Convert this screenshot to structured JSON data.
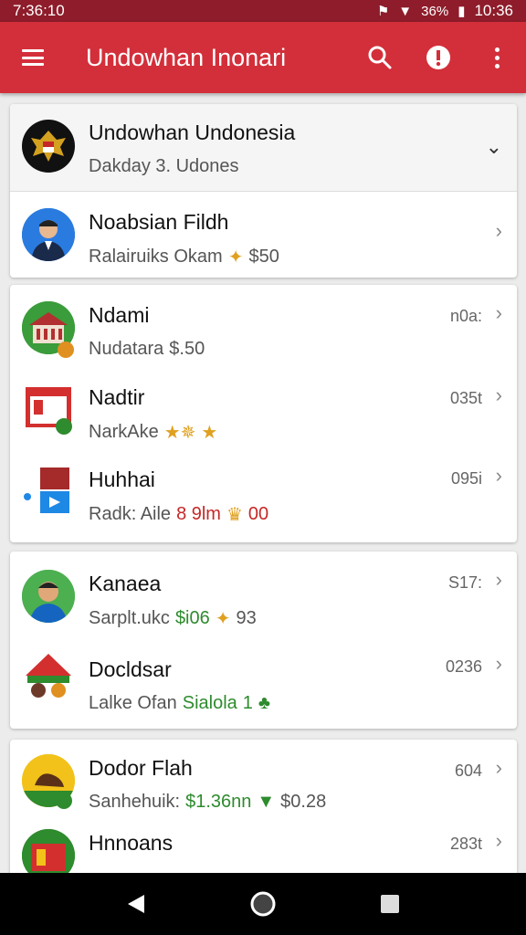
{
  "status_bar": {
    "time_left": "7:36:10",
    "time_right": "10:36",
    "battery": "36%"
  },
  "app_bar": {
    "title": "Undowhan Inonari",
    "icons": [
      "menu-icon",
      "search-icon",
      "alert-icon",
      "more-vert-icon"
    ]
  },
  "header_card": {
    "title": "Undowhan Undonesia",
    "subtitle": "Dakday 3. Udones",
    "icon": "chevron-down-icon"
  },
  "profile_row": {
    "title": "Noabsian Fildh",
    "subtitle": "Ralairuiks Okam",
    "amount": "$50"
  },
  "group1": [
    {
      "title": "Ndami",
      "subtitle": "Nudatara",
      "value": "$.50",
      "meta": "n0a:"
    },
    {
      "title": "Nadtir",
      "subtitle": "NarkAke",
      "value": "",
      "meta": "035t"
    },
    {
      "title": "Huhhai",
      "subtitle": "Radk: Aile",
      "value": "8 9lm",
      "value2": "00",
      "meta": "095i"
    }
  ],
  "group2": [
    {
      "title": "Kanaea",
      "subtitle": "Sarplt.ukc",
      "value": "$i06",
      "value2": "93",
      "meta": "S17:"
    },
    {
      "title": "Docldsar",
      "subtitle": "Lalke Ofan",
      "value": "Sialola",
      "value2": "1",
      "meta": "0236"
    }
  ],
  "group3": [
    {
      "title": "Dodor Flah",
      "subtitle": "Sanhehuik:",
      "value": "$1.36nn",
      "value2": "$0.28",
      "meta": "604"
    },
    {
      "title": "Hnnoans",
      "subtitle": "",
      "value": "",
      "meta": "283t"
    }
  ],
  "nav_bar": {
    "icons": [
      "back-icon",
      "home-icon",
      "recents-icon"
    ]
  },
  "colors": {
    "app_bar": "#d32f3a",
    "status_bar": "#8e1c2a",
    "green": "#2e8b2e",
    "star": "#e0a020"
  }
}
